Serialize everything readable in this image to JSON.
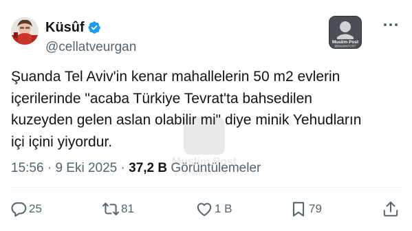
{
  "author": {
    "display_name": "Küsûf",
    "handle": "@cellatveurgan",
    "verified": true,
    "verified_color": "#1d9bf0"
  },
  "badge": {
    "name": "Muslim Post",
    "handle": "@MuslimPOST"
  },
  "tweet": {
    "lines": [
      "Şuanda Tel Aviv'in kenar mahallelerin 50 m2 evlerin",
      "içerilerinde \"acaba Türkiye Tevrat'ta bahsedilen",
      "kuzeyden gelen aslan olabilir mi\" diye minik Yehudların",
      "içi içini yiyordur."
    ]
  },
  "meta": {
    "time": "15:56",
    "separator": " · ",
    "date": "9 Eki 2025",
    "views_count": "37,2 B",
    "views_label": "Görüntülemeler"
  },
  "actions": {
    "reply_count": "25",
    "retweet_count": "81",
    "like_count": "1 B",
    "bookmark_count": "79"
  },
  "icons": [
    "verified-badge-icon",
    "more-icon",
    "reply-icon",
    "retweet-icon",
    "like-icon",
    "bookmark-icon",
    "share-icon"
  ]
}
